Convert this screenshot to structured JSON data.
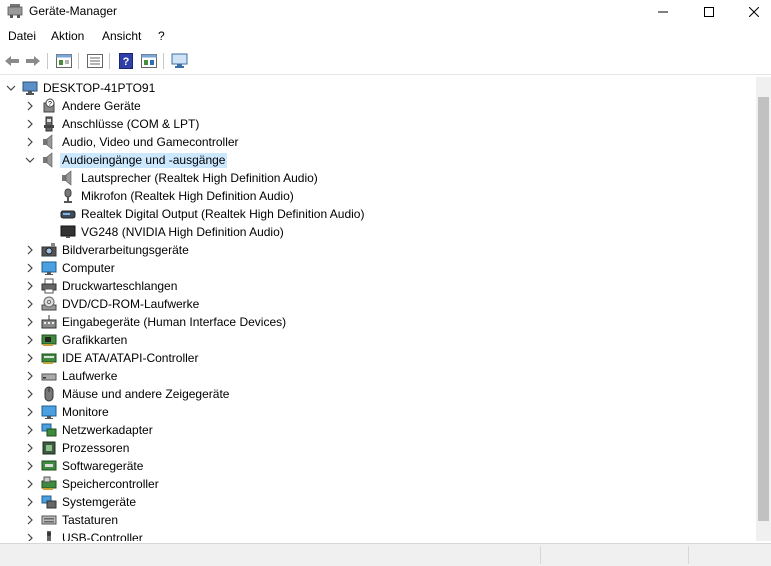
{
  "window": {
    "title": "Geräte-Manager"
  },
  "menu": [
    "Datei",
    "Aktion",
    "Ansicht",
    "?"
  ],
  "toolbar": [
    "back-icon",
    "forward-icon",
    "properties-icon",
    "device-list-icon",
    "help-icon",
    "update-driver-icon",
    "scan-hardware-icon"
  ],
  "tree": {
    "root": "DESKTOP-41PTO91",
    "items": [
      {
        "label": "Andere Geräte",
        "icon": "unknown-device-icon",
        "expanded": false
      },
      {
        "label": "Anschlüsse (COM & LPT)",
        "icon": "port-icon",
        "expanded": false
      },
      {
        "label": "Audio, Video und Gamecontroller",
        "icon": "speaker-icon",
        "expanded": false
      },
      {
        "label": "Audioeingänge und -ausgänge",
        "icon": "speaker-icon",
        "expanded": true,
        "selected": true,
        "children": [
          {
            "label": "Lautsprecher (Realtek High Definition Audio)",
            "icon": "speaker-icon"
          },
          {
            "label": "Mikrofon (Realtek High Definition Audio)",
            "icon": "microphone-icon"
          },
          {
            "label": "Realtek Digital Output (Realtek High Definition Audio)",
            "icon": "digital-output-icon"
          },
          {
            "label": "VG248 (NVIDIA High Definition Audio)",
            "icon": "monitor-audio-icon"
          }
        ]
      },
      {
        "label": "Bildverarbeitungsgeräte",
        "icon": "camera-icon",
        "expanded": false
      },
      {
        "label": "Computer",
        "icon": "computer-icon",
        "expanded": false
      },
      {
        "label": "Druckwarteschlangen",
        "icon": "printer-icon",
        "expanded": false
      },
      {
        "label": "DVD/CD-ROM-Laufwerke",
        "icon": "dvd-drive-icon",
        "expanded": false
      },
      {
        "label": "Eingabegeräte (Human Interface Devices)",
        "icon": "hid-icon",
        "expanded": false
      },
      {
        "label": "Grafikkarten",
        "icon": "graphics-card-icon",
        "expanded": false
      },
      {
        "label": "IDE ATA/ATAPI-Controller",
        "icon": "ide-controller-icon",
        "expanded": false
      },
      {
        "label": "Laufwerke",
        "icon": "disk-drive-icon",
        "expanded": false
      },
      {
        "label": "Mäuse und andere Zeigegeräte",
        "icon": "mouse-icon",
        "expanded": false
      },
      {
        "label": "Monitore",
        "icon": "monitor-icon",
        "expanded": false
      },
      {
        "label": "Netzwerkadapter",
        "icon": "network-adapter-icon",
        "expanded": false
      },
      {
        "label": "Prozessoren",
        "icon": "processor-icon",
        "expanded": false
      },
      {
        "label": "Softwaregeräte",
        "icon": "software-device-icon",
        "expanded": false
      },
      {
        "label": "Speichercontroller",
        "icon": "storage-controller-icon",
        "expanded": false
      },
      {
        "label": "Systemgeräte",
        "icon": "system-device-icon",
        "expanded": false
      },
      {
        "label": "Tastaturen",
        "icon": "keyboard-icon",
        "expanded": false
      },
      {
        "label": "USB-Controller",
        "icon": "usb-controller-icon",
        "expanded": false
      }
    ]
  },
  "colors": {
    "selection": "#cce8ff",
    "scrollbar_thumb": "#c1c1c1"
  }
}
